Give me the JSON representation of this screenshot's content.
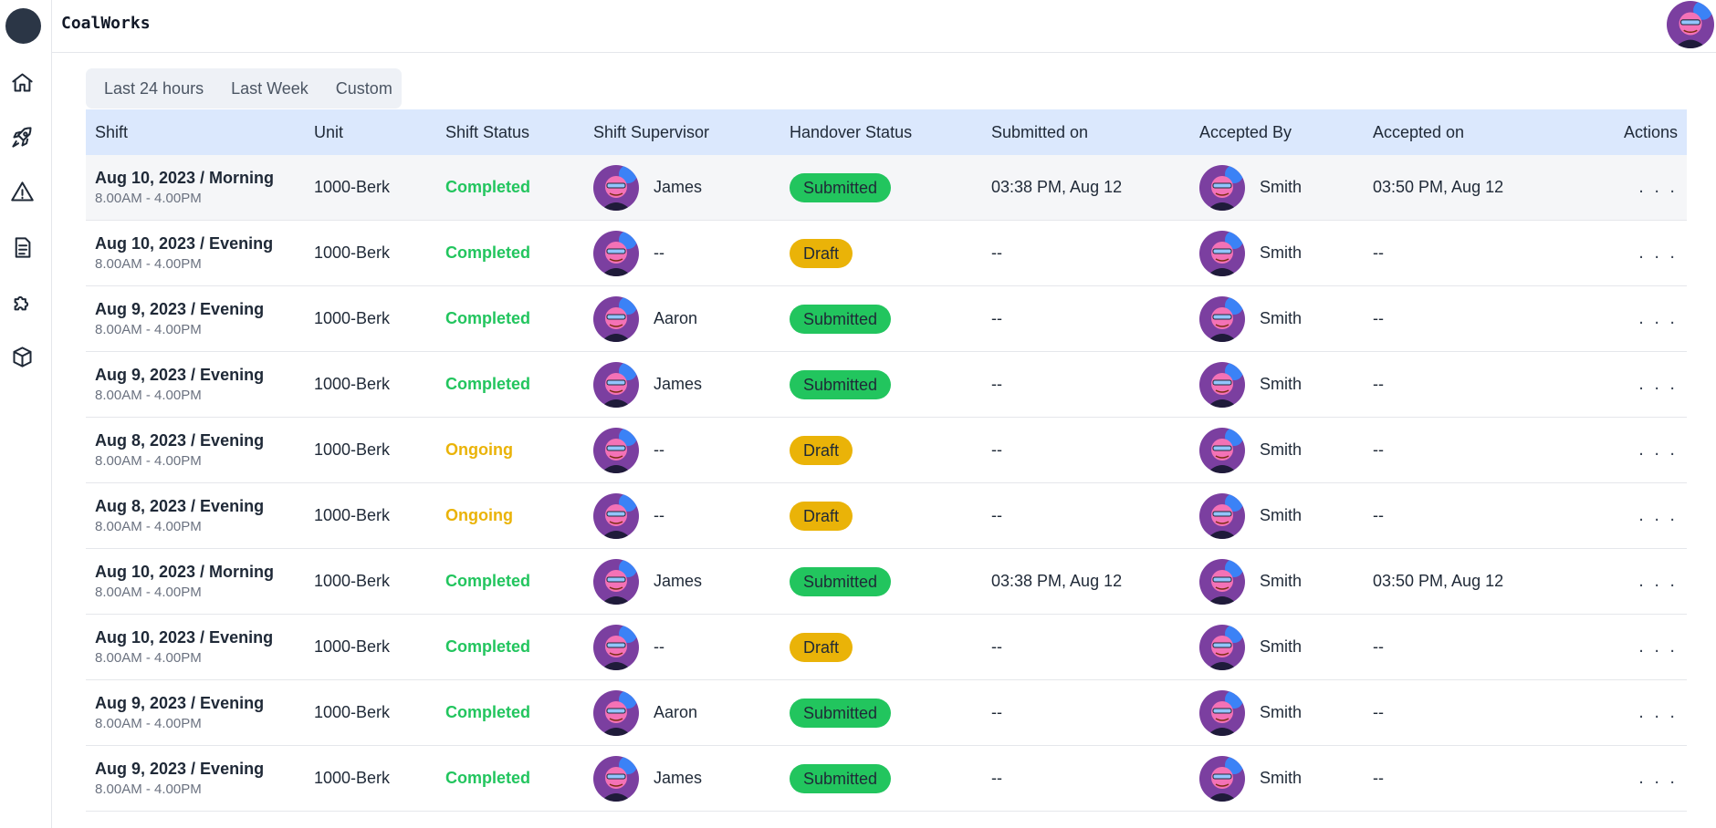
{
  "app": {
    "title": "CoalWorks"
  },
  "sidebar": {
    "items": [
      {
        "name": "home-icon"
      },
      {
        "name": "rocket-icon"
      },
      {
        "name": "warning-icon"
      },
      {
        "name": "document-icon"
      },
      {
        "name": "puzzle-icon"
      },
      {
        "name": "cube-icon"
      }
    ]
  },
  "filters": [
    "Last 24 hours",
    "Last Week",
    "Custom"
  ],
  "table": {
    "headers": [
      "Shift",
      "Unit",
      "Shift Status",
      "Shift Supervisor",
      "Handover Status",
      "Submitted on",
      "Accepted By",
      "Accepted on",
      "Actions"
    ],
    "actions_label": ". . .",
    "rows": [
      {
        "shift": "Aug 10, 2023 / Morning",
        "time": "8.00AM - 4.00PM",
        "unit": "1000-Berk",
        "status": "Completed",
        "supervisor": "James",
        "handover": "Submitted",
        "submitted_on": "03:38 PM, Aug 12",
        "accepted_by": "Smith",
        "accepted_on": "03:50 PM, Aug 12"
      },
      {
        "shift": "Aug 10, 2023 / Evening",
        "time": "8.00AM - 4.00PM",
        "unit": "1000-Berk",
        "status": "Completed",
        "supervisor": "--",
        "handover": "Draft",
        "submitted_on": "--",
        "accepted_by": "Smith",
        "accepted_on": "--"
      },
      {
        "shift": "Aug 9, 2023 / Evening",
        "time": "8.00AM - 4.00PM",
        "unit": "1000-Berk",
        "status": "Completed",
        "supervisor": "Aaron",
        "handover": "Submitted",
        "submitted_on": "--",
        "accepted_by": "Smith",
        "accepted_on": "--"
      },
      {
        "shift": "Aug 9, 2023 / Evening",
        "time": "8.00AM - 4.00PM",
        "unit": "1000-Berk",
        "status": "Completed",
        "supervisor": "James",
        "handover": "Submitted",
        "submitted_on": "--",
        "accepted_by": "Smith",
        "accepted_on": "--"
      },
      {
        "shift": "Aug 8, 2023 / Evening",
        "time": "8.00AM - 4.00PM",
        "unit": "1000-Berk",
        "status": "Ongoing",
        "supervisor": "--",
        "handover": "Draft",
        "submitted_on": "--",
        "accepted_by": "Smith",
        "accepted_on": "--"
      },
      {
        "shift": "Aug 8, 2023 / Evening",
        "time": "8.00AM - 4.00PM",
        "unit": "1000-Berk",
        "status": "Ongoing",
        "supervisor": "--",
        "handover": "Draft",
        "submitted_on": "--",
        "accepted_by": "Smith",
        "accepted_on": "--"
      },
      {
        "shift": "Aug 10, 2023 / Morning",
        "time": "8.00AM - 4.00PM",
        "unit": "1000-Berk",
        "status": "Completed",
        "supervisor": "James",
        "handover": "Submitted",
        "submitted_on": "03:38 PM, Aug 12",
        "accepted_by": "Smith",
        "accepted_on": "03:50 PM, Aug 12"
      },
      {
        "shift": "Aug 10, 2023 / Evening",
        "time": "8.00AM - 4.00PM",
        "unit": "1000-Berk",
        "status": "Completed",
        "supervisor": "--",
        "handover": "Draft",
        "submitted_on": "--",
        "accepted_by": "Smith",
        "accepted_on": "--"
      },
      {
        "shift": "Aug 9, 2023 / Evening",
        "time": "8.00AM - 4.00PM",
        "unit": "1000-Berk",
        "status": "Completed",
        "supervisor": "Aaron",
        "handover": "Submitted",
        "submitted_on": "--",
        "accepted_by": "Smith",
        "accepted_on": "--"
      },
      {
        "shift": "Aug 9, 2023 / Evening",
        "time": "8.00AM - 4.00PM",
        "unit": "1000-Berk",
        "status": "Completed",
        "supervisor": "James",
        "handover": "Submitted",
        "submitted_on": "--",
        "accepted_by": "Smith",
        "accepted_on": "--"
      }
    ]
  },
  "colors": {
    "completed": "#22c55e",
    "ongoing": "#eab308",
    "submitted_pill": "#22c55e",
    "draft_pill": "#eab308",
    "header_bg": "#dbe8fd"
  }
}
